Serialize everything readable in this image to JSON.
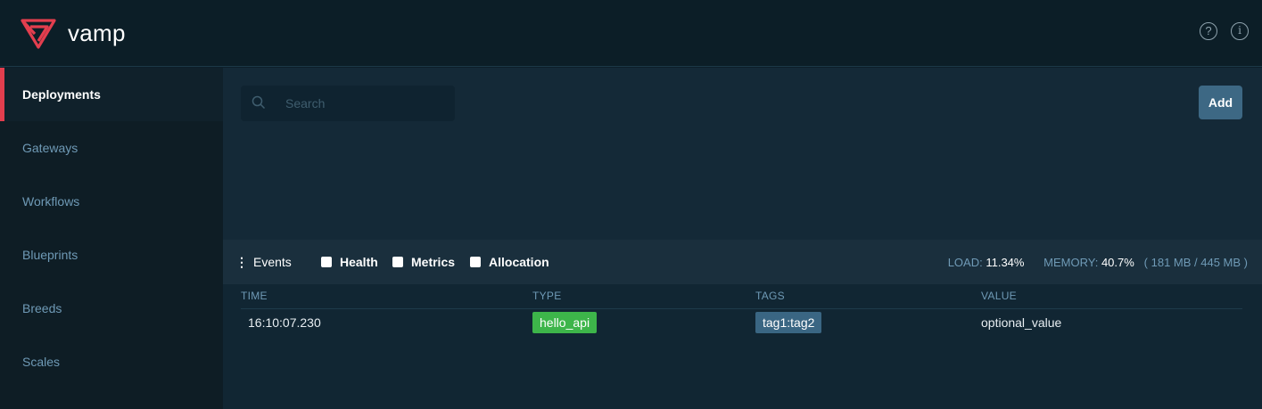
{
  "app": {
    "name": "vamp"
  },
  "colors": {
    "brand": "#e33e4e",
    "accent_button": "#3d6884",
    "type_badge": "#3db54a",
    "tag_badge": "#3a6683"
  },
  "header": {
    "help_icon": "?",
    "info_icon": "i"
  },
  "sidebar": {
    "items": [
      {
        "label": "Deployments",
        "active": true
      },
      {
        "label": "Gateways"
      },
      {
        "label": "Workflows"
      },
      {
        "label": "Blueprints"
      },
      {
        "label": "Breeds"
      },
      {
        "label": "Scales"
      }
    ]
  },
  "toolbar": {
    "search_placeholder": "Search",
    "add_label": "Add"
  },
  "events": {
    "title": "Events",
    "filters": [
      {
        "label": "Health",
        "checked": false
      },
      {
        "label": "Metrics",
        "checked": false
      },
      {
        "label": "Allocation",
        "checked": false
      }
    ],
    "load_label": "LOAD:",
    "load_value": "11.34%",
    "memory_label": "MEMORY:",
    "memory_value": "40.7%",
    "memory_detail": "( 181 MB / 445 MB )",
    "columns": [
      "TIME",
      "TYPE",
      "TAGS",
      "VALUE"
    ],
    "rows": [
      {
        "time": "16:10:07.230",
        "type": "hello_api",
        "tags": "tag1:tag2",
        "value": "optional_value"
      }
    ]
  }
}
